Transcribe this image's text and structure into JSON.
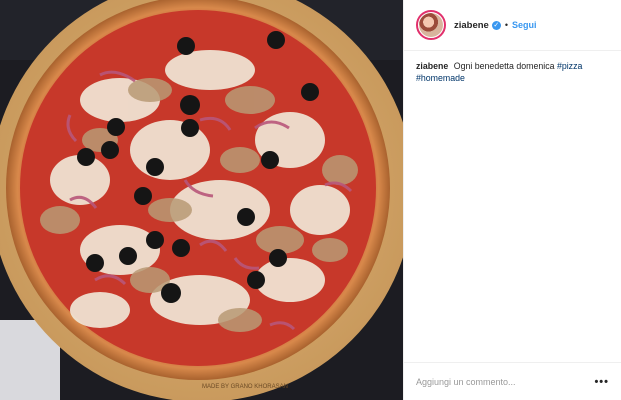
{
  "post": {
    "username": "ziabene",
    "verified_icon": "verified-badge-icon",
    "separator": "•",
    "follow_label": "Segui",
    "caption_text": "Ogni benedetta domenica",
    "hashtags": [
      "#pizza",
      "#homemade"
    ],
    "board_stamp": "MADE BY GRANO KHORASAN"
  },
  "comment": {
    "placeholder": "Aggiungi un commento...",
    "more_icon": "more-options-icon",
    "more_label": "•••"
  },
  "colors": {
    "accent": "#3897f0",
    "story_ring": "#e1306c",
    "text": "#262626",
    "hashtag": "#003569"
  }
}
